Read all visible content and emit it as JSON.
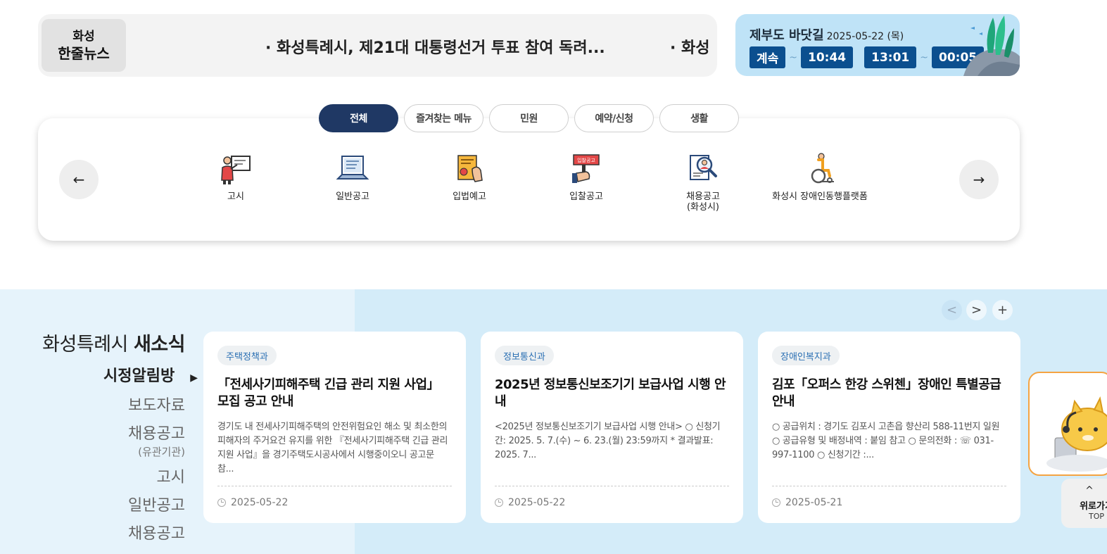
{
  "news_ticker": {
    "label_line1": "화성",
    "label_line2": "한줄뉴스",
    "items": [
      "· 화성특례시, 제21대 대통령선거 투표 참여 독려...",
      "· 화성"
    ]
  },
  "tide": {
    "location": "제부도 바닷길",
    "date": "2025-05-22 (목)",
    "status": "계속",
    "time1": "10:44",
    "time2": "13:01",
    "time3": "00:05",
    "tilde": "~"
  },
  "quick_menu": {
    "tabs": [
      "전체",
      "즐겨찾는 메뉴",
      "민원",
      "예약/신청",
      "생활"
    ],
    "active_tab": "전체",
    "prev_icon": "←",
    "next_icon": "→",
    "items": [
      {
        "label": "고시",
        "icon": "teacher-board-icon"
      },
      {
        "label": "일반공고",
        "icon": "laptop-icon"
      },
      {
        "label": "입법예고",
        "icon": "document-hand-icon"
      },
      {
        "label": "입찰공고",
        "icon": "auction-sign-icon"
      },
      {
        "label": "채용공고\n(화성시)",
        "icon": "recruit-search-icon"
      },
      {
        "label": "화성시 장애인동행플랫폼",
        "icon": "wheelchair-icon"
      }
    ],
    "auction_sign_text": "입찰공고"
  },
  "news_section": {
    "title_prefix": "화성특례시 ",
    "title_bold": "새소식",
    "categories": [
      {
        "label": "시정알림방",
        "active": true
      },
      {
        "label": "보도자료"
      },
      {
        "label": "채용공고"
      },
      {
        "label": "(유관기관)",
        "sub": true
      },
      {
        "label": "고시"
      },
      {
        "label": "일반공고"
      },
      {
        "label": "채용공고"
      }
    ],
    "active_marker": "▶",
    "controls": {
      "prev": "<",
      "next": ">",
      "more": "+"
    },
    "cards": [
      {
        "department": "주택정책과",
        "title": "「전세사기피해주택 긴급 관리 지원 사업」 모집 공고 안내",
        "desc": "경기도 내 전세사기피해주택의 안전위험요인 해소 및 최소한의 피해자의 주거요건 유지를 위한 『전세사기피해주택 긴급 관리 지원 사업』을 경기주택도시공사에서 시행중이오니 공고문 참...",
        "date": "2025-05-22"
      },
      {
        "department": "정보통신과",
        "title": "2025년 정보통신보조기기 보급사업 시행 안내",
        "desc": "<2025년 정보통신보조기기 보급사업 시행 안내> ○ 신청기간: 2025. 5. 7.(수) ~ 6. 23.(월) 23:59까지 * 결과발표: 2025. 7...",
        "date": "2025-05-22"
      },
      {
        "department": "장애인복지과",
        "title": "김포「오퍼스 한강 스위첸」장애인 특별공급 안내",
        "desc": "○ 공급위치 : 경기도 김포시 고촌읍 향산리 588-11번지 일원 ○ 공급유형 및 배정내역 : 붙임 참고 ○ 문의전화 : ☏ 031-997-1100 ○ 신청기간 :...",
        "date": "2025-05-21"
      }
    ]
  },
  "floating": {
    "top_label": "위로가기",
    "top_sub": "TOP",
    "top_arrow": "^"
  },
  "colors": {
    "accent_navy": "#1f3864",
    "tide_blue": "#0b4f8f",
    "section_bg": "#d4ecf9",
    "chatbot_border": "#f5a442"
  }
}
